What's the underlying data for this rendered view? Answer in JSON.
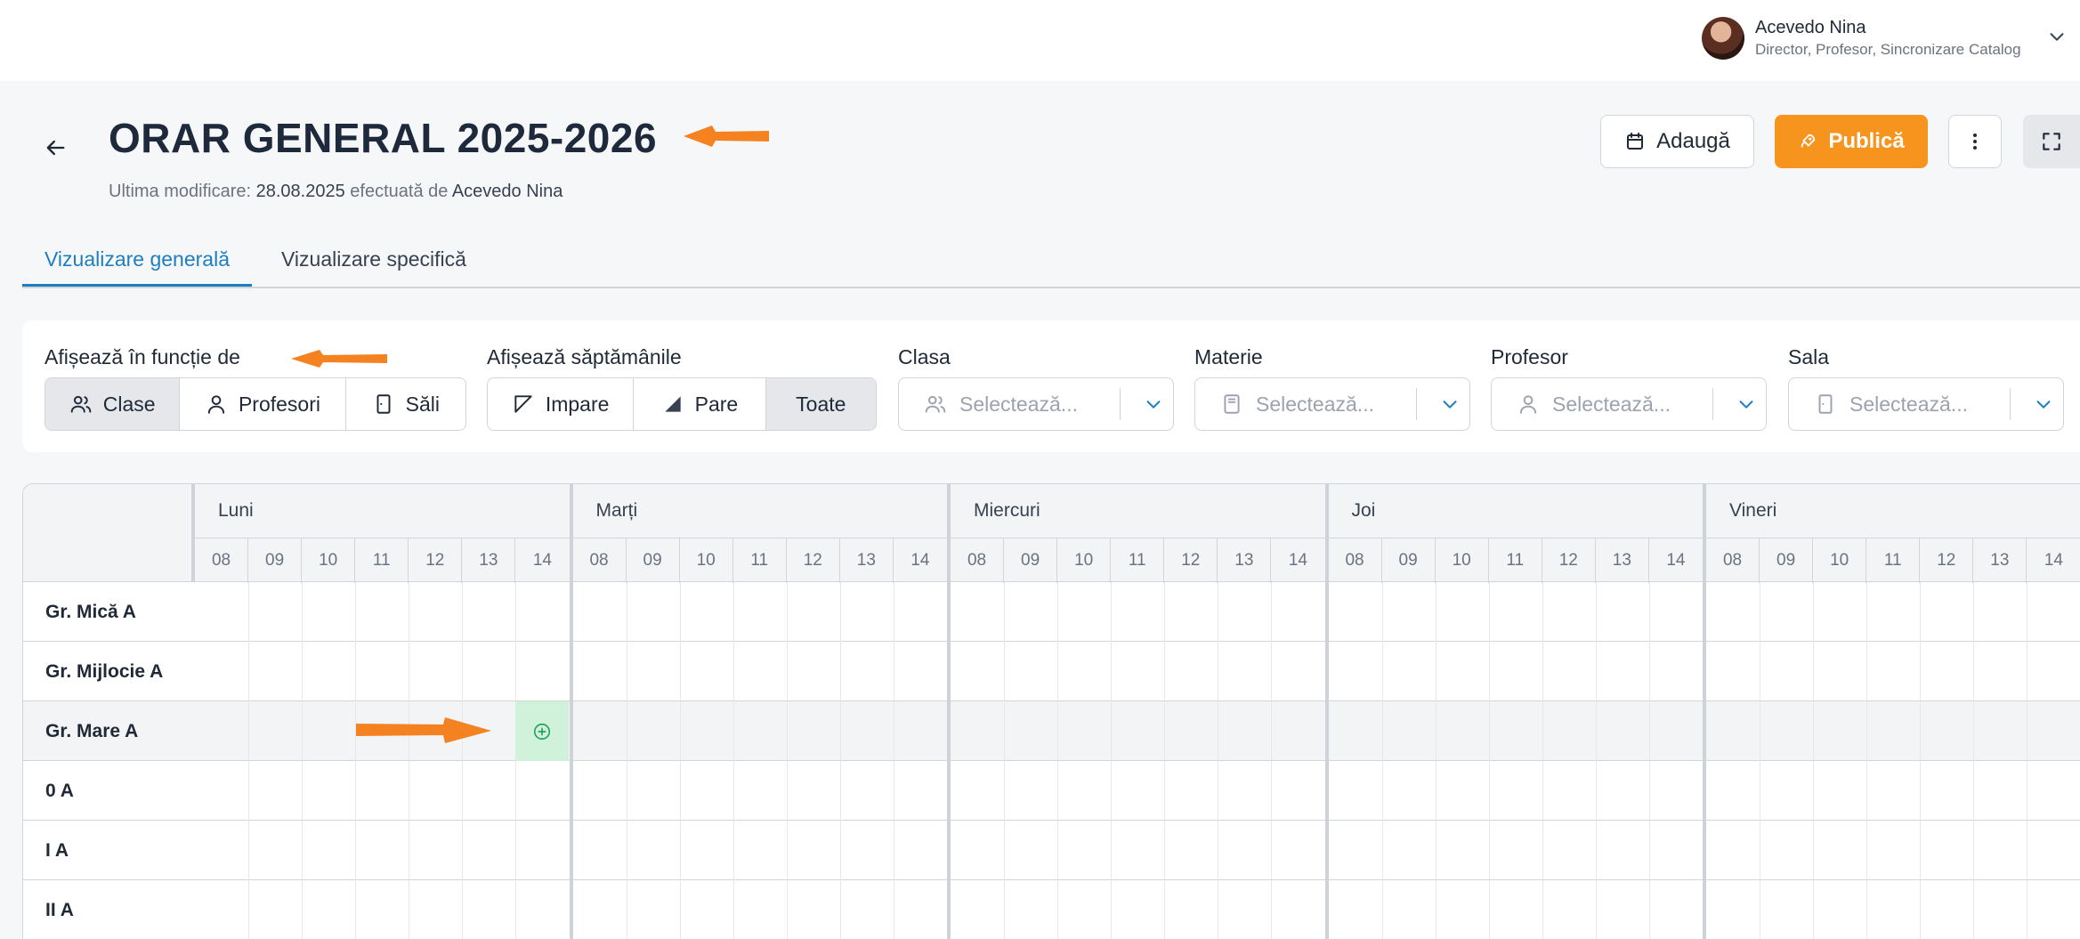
{
  "user": {
    "name": "Acevedo Nina",
    "role": "Director, Profesor, Sincronizare Catalog"
  },
  "header": {
    "title": "ORAR GENERAL 2025-2026",
    "last_mod_prefix": "Ultima modificare:",
    "last_mod_date": "28.08.2025",
    "last_mod_by_text": "efectuată de",
    "last_mod_user": "Acevedo Nina",
    "add_label": "Adaugă",
    "publish_label": "Publică"
  },
  "tabs": [
    {
      "label": "Vizualizare generală",
      "active": true
    },
    {
      "label": "Vizualizare specifică",
      "active": false
    }
  ],
  "filters": {
    "display_by_label": "Afișează în funcție de",
    "display_by_options": [
      "Clase",
      "Profesori",
      "Săli"
    ],
    "display_by_selected": "Clase",
    "weeks_label": "Afișează săptămânile",
    "weeks_options": [
      "Impare",
      "Pare",
      "Toate"
    ],
    "weeks_selected": "Toate",
    "class_label": "Clasa",
    "subject_label": "Materie",
    "teacher_label": "Profesor",
    "room_label": "Sala",
    "placeholder": "Selectează..."
  },
  "schedule": {
    "days": [
      "Luni",
      "Marți",
      "Miercuri",
      "Joi",
      "Vineri"
    ],
    "hours": [
      "08",
      "09",
      "10",
      "11",
      "12",
      "13",
      "14"
    ],
    "rows": [
      "Gr. Mică A",
      "Gr. Mijlocie A",
      "Gr. Mare A",
      "0 A",
      "I A",
      "II A"
    ],
    "highlighted_row": "Gr. Mare A",
    "add_cell": {
      "row": "Gr. Mare A",
      "day": "Luni",
      "hour": "14"
    }
  },
  "colors": {
    "accent": "#1d7fbf",
    "publish": "#f7941d",
    "annotation_arrow": "#f58220",
    "add_cell": "#d1f2da"
  }
}
